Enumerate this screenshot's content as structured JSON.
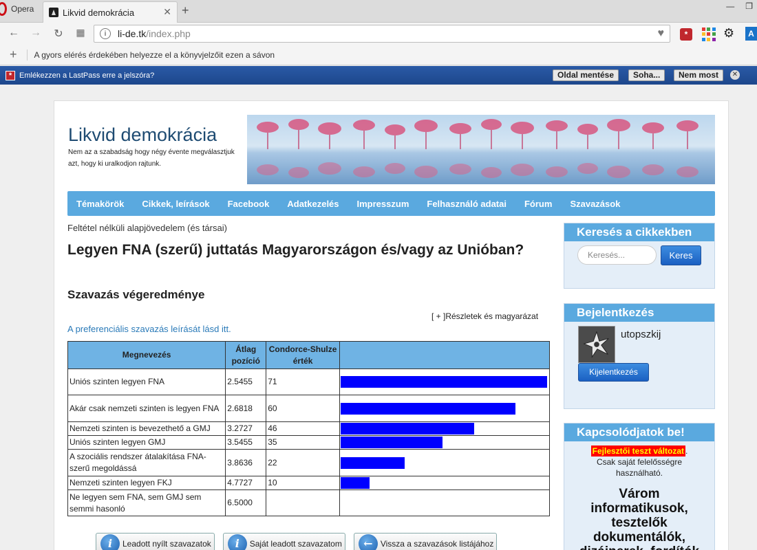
{
  "browser": {
    "app_name": "Opera",
    "tab_title": "Likvid demokrácia",
    "url_host": "li-de.tk",
    "url_path": "/index.php",
    "bookmarks_hint": "A gyors elérés érdekében helyezze el a könyvjelzőit ezen a sávon",
    "lastpass": {
      "prompt": "Emlékezzen a LastPass erre a jelszóra?",
      "save_label": "Oldal mentése",
      "never_label": "Soha...",
      "not_now_label": "Nem most"
    }
  },
  "site": {
    "title": "Likvid demokrácia",
    "subtitle": "Nem az a szabadság hogy négy évente megválasztjuk azt, hogy ki uralkodjon rajtunk."
  },
  "menu": [
    "Témakörök",
    "Cikkek, leírások",
    "Facebook",
    "Adatkezelés",
    "Impresszum",
    "Felhasználó adatai",
    "Fórum",
    "Szavazások"
  ],
  "content": {
    "breadcrumb": "Feltétel nélküli alapjövedelem (és társai)",
    "heading": "Legyen FNA (szerű) juttatás Magyarországon és/vagy az Unióban?",
    "result_heading": "Szavazás végeredménye",
    "details_link": "[ + ]Részletek és magyarázat",
    "pref_link": "A preferenciális szavazás leírását lásd itt.",
    "table": {
      "headers": [
        "Megnevezés",
        "Átlag pozíció",
        "Condorce-Shulze érték",
        ""
      ],
      "max_value": 71,
      "rows": [
        {
          "name": "Uniós szinten legyen FNA",
          "avg": "2.5455",
          "score": "71",
          "value": 71
        },
        {
          "name": "Akár csak nemzeti szinten is legyen FNA",
          "avg": "2.6818",
          "score": "60",
          "value": 60
        },
        {
          "name": "Nemzeti szinten is bevezethető a GMJ",
          "avg": "3.2727",
          "score": "46",
          "value": 46
        },
        {
          "name": "Uniós szinten legyen GMJ",
          "avg": "3.5455",
          "score": "35",
          "value": 35
        },
        {
          "name": "A szociális rendszer átalakítása FNA-szerű megoldássá",
          "avg": "3.8636",
          "score": "22",
          "value": 22
        },
        {
          "name": "Nemzeti szinten legyen FKJ",
          "avg": "4.7727",
          "score": "10",
          "value": 10
        },
        {
          "name": "Ne legyen sem FNA, sem GMJ sem semmi hasonló",
          "avg": "6.5000",
          "score": "",
          "value": 0
        }
      ]
    },
    "buttons": {
      "open_votes": "Leadott nyílt szavazatok",
      "my_votes": "Saját leadott szavazatom",
      "back": "Vissza a szavazások listájához"
    }
  },
  "sidebar": {
    "search": {
      "title": "Keresés a cikkekben",
      "placeholder": "Keresés...",
      "button": "Keres"
    },
    "login": {
      "title": "Bejelentkezés",
      "username": "utopszkij",
      "logout": "Kijelentkezés"
    },
    "connect": {
      "title": "Kapcsolódjatok be!",
      "badge": "Fejlesztői teszt változat",
      "badge_suffix": ".",
      "note": "Csak saját felelősségre használható.",
      "call": "Várom informatikusok, tesztelők dokumentálók, dizájnerek, fordítók"
    }
  },
  "colors": {
    "accent": "#5aa9df",
    "bar": "#0000ff",
    "title": "#1e4b72"
  }
}
